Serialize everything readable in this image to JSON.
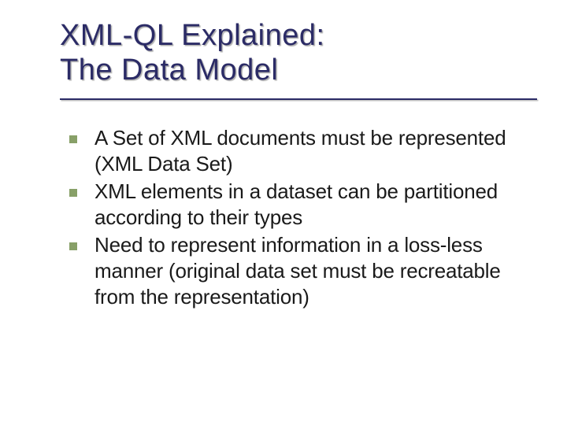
{
  "title": {
    "line1": "XML-QL Explained:",
    "line2": "The Data Model"
  },
  "bullets": [
    {
      "text": "A Set of XML documents must be represented (XML Data Set)"
    },
    {
      "text": "XML elements in a dataset can be partitioned according to their types"
    },
    {
      "text": "Need to represent information in a  loss-less manner (original data set must be recreatable from the representation)"
    }
  ]
}
